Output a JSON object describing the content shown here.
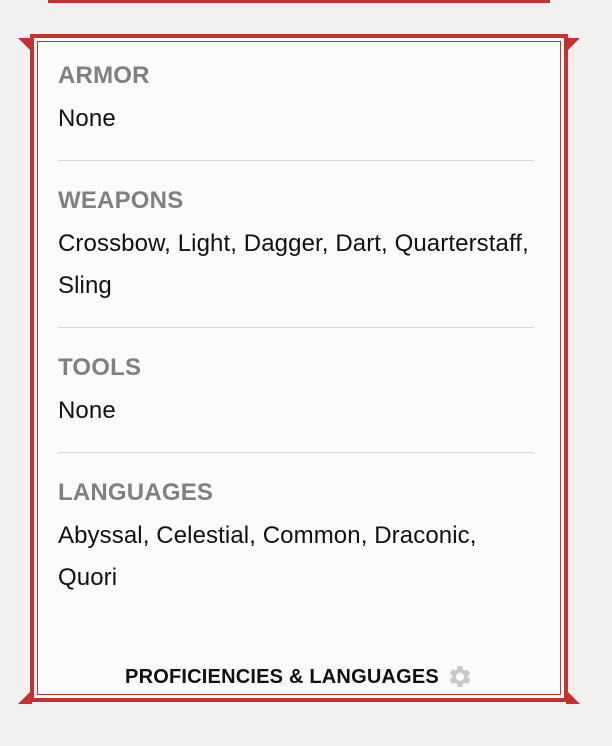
{
  "sections": [
    {
      "title": "ARMOR",
      "value": "None"
    },
    {
      "title": "WEAPONS",
      "value": "Crossbow, Light, Dagger, Dart, Quarterstaff, Sling"
    },
    {
      "title": "TOOLS",
      "value": "None"
    },
    {
      "title": "LANGUAGES",
      "value": "Abyssal, Celestial, Common, Draconic, Quori"
    }
  ],
  "footer": {
    "title": "PROFICIENCIES & LANGUAGES",
    "icon": "gear-icon"
  },
  "colors": {
    "frame": "#c53131",
    "panel": "#fbfbfb",
    "muted_heading": "#808080",
    "text": "#111111",
    "icon": "#c9c9c9"
  }
}
